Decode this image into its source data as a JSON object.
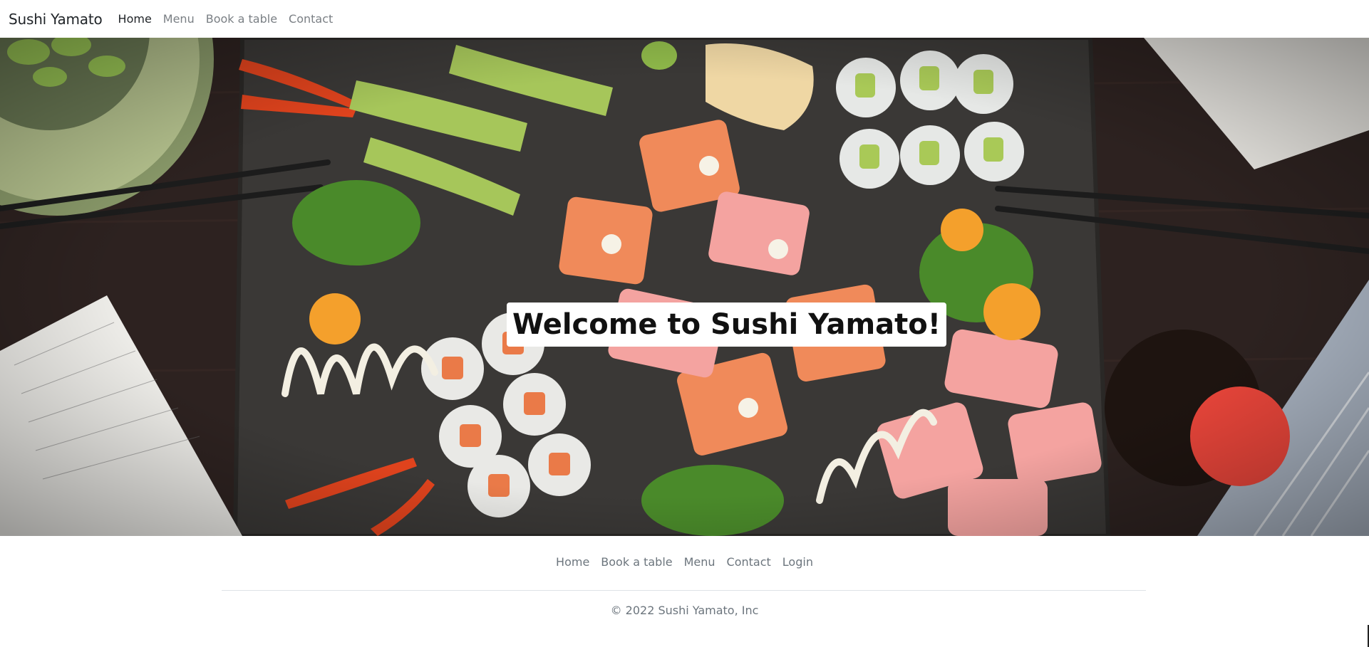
{
  "navbar": {
    "brand": "Sushi Yamato",
    "items": [
      {
        "label": "Home",
        "active": true
      },
      {
        "label": "Menu",
        "active": false
      },
      {
        "label": "Book a table",
        "active": false
      },
      {
        "label": "Contact",
        "active": false
      }
    ]
  },
  "hero": {
    "heading": "Welcome to Sushi Yamato!"
  },
  "footer": {
    "links": [
      "Home",
      "Book a table",
      "Menu",
      "Contact",
      "Login"
    ],
    "copyright": "© 2022 Sushi Yamato, Inc"
  },
  "colors": {
    "table_wood": "#2d2220",
    "slate_board": "#3a3836",
    "salmon": "#f08a5a",
    "tuna": "#f4a3a0",
    "avocado": "#9cc956",
    "text_muted": "#6c757d"
  },
  "icons": [
    "hero-photo"
  ]
}
